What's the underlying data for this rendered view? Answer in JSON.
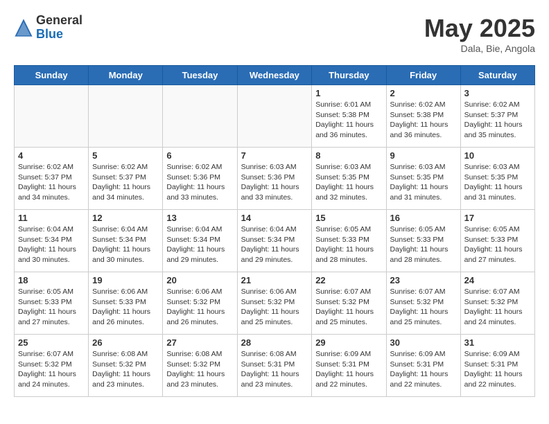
{
  "header": {
    "logo_general": "General",
    "logo_blue": "Blue",
    "month": "May 2025",
    "location": "Dala, Bie, Angola"
  },
  "days_of_week": [
    "Sunday",
    "Monday",
    "Tuesday",
    "Wednesday",
    "Thursday",
    "Friday",
    "Saturday"
  ],
  "weeks": [
    [
      {
        "day": "",
        "info": ""
      },
      {
        "day": "",
        "info": ""
      },
      {
        "day": "",
        "info": ""
      },
      {
        "day": "",
        "info": ""
      },
      {
        "day": "1",
        "info": "Sunrise: 6:01 AM\nSunset: 5:38 PM\nDaylight: 11 hours and 36 minutes."
      },
      {
        "day": "2",
        "info": "Sunrise: 6:02 AM\nSunset: 5:38 PM\nDaylight: 11 hours and 36 minutes."
      },
      {
        "day": "3",
        "info": "Sunrise: 6:02 AM\nSunset: 5:37 PM\nDaylight: 11 hours and 35 minutes."
      }
    ],
    [
      {
        "day": "4",
        "info": "Sunrise: 6:02 AM\nSunset: 5:37 PM\nDaylight: 11 hours and 34 minutes."
      },
      {
        "day": "5",
        "info": "Sunrise: 6:02 AM\nSunset: 5:37 PM\nDaylight: 11 hours and 34 minutes."
      },
      {
        "day": "6",
        "info": "Sunrise: 6:02 AM\nSunset: 5:36 PM\nDaylight: 11 hours and 33 minutes."
      },
      {
        "day": "7",
        "info": "Sunrise: 6:03 AM\nSunset: 5:36 PM\nDaylight: 11 hours and 33 minutes."
      },
      {
        "day": "8",
        "info": "Sunrise: 6:03 AM\nSunset: 5:35 PM\nDaylight: 11 hours and 32 minutes."
      },
      {
        "day": "9",
        "info": "Sunrise: 6:03 AM\nSunset: 5:35 PM\nDaylight: 11 hours and 31 minutes."
      },
      {
        "day": "10",
        "info": "Sunrise: 6:03 AM\nSunset: 5:35 PM\nDaylight: 11 hours and 31 minutes."
      }
    ],
    [
      {
        "day": "11",
        "info": "Sunrise: 6:04 AM\nSunset: 5:34 PM\nDaylight: 11 hours and 30 minutes."
      },
      {
        "day": "12",
        "info": "Sunrise: 6:04 AM\nSunset: 5:34 PM\nDaylight: 11 hours and 30 minutes."
      },
      {
        "day": "13",
        "info": "Sunrise: 6:04 AM\nSunset: 5:34 PM\nDaylight: 11 hours and 29 minutes."
      },
      {
        "day": "14",
        "info": "Sunrise: 6:04 AM\nSunset: 5:34 PM\nDaylight: 11 hours and 29 minutes."
      },
      {
        "day": "15",
        "info": "Sunrise: 6:05 AM\nSunset: 5:33 PM\nDaylight: 11 hours and 28 minutes."
      },
      {
        "day": "16",
        "info": "Sunrise: 6:05 AM\nSunset: 5:33 PM\nDaylight: 11 hours and 28 minutes."
      },
      {
        "day": "17",
        "info": "Sunrise: 6:05 AM\nSunset: 5:33 PM\nDaylight: 11 hours and 27 minutes."
      }
    ],
    [
      {
        "day": "18",
        "info": "Sunrise: 6:05 AM\nSunset: 5:33 PM\nDaylight: 11 hours and 27 minutes."
      },
      {
        "day": "19",
        "info": "Sunrise: 6:06 AM\nSunset: 5:33 PM\nDaylight: 11 hours and 26 minutes."
      },
      {
        "day": "20",
        "info": "Sunrise: 6:06 AM\nSunset: 5:32 PM\nDaylight: 11 hours and 26 minutes."
      },
      {
        "day": "21",
        "info": "Sunrise: 6:06 AM\nSunset: 5:32 PM\nDaylight: 11 hours and 25 minutes."
      },
      {
        "day": "22",
        "info": "Sunrise: 6:07 AM\nSunset: 5:32 PM\nDaylight: 11 hours and 25 minutes."
      },
      {
        "day": "23",
        "info": "Sunrise: 6:07 AM\nSunset: 5:32 PM\nDaylight: 11 hours and 25 minutes."
      },
      {
        "day": "24",
        "info": "Sunrise: 6:07 AM\nSunset: 5:32 PM\nDaylight: 11 hours and 24 minutes."
      }
    ],
    [
      {
        "day": "25",
        "info": "Sunrise: 6:07 AM\nSunset: 5:32 PM\nDaylight: 11 hours and 24 minutes."
      },
      {
        "day": "26",
        "info": "Sunrise: 6:08 AM\nSunset: 5:32 PM\nDaylight: 11 hours and 23 minutes."
      },
      {
        "day": "27",
        "info": "Sunrise: 6:08 AM\nSunset: 5:32 PM\nDaylight: 11 hours and 23 minutes."
      },
      {
        "day": "28",
        "info": "Sunrise: 6:08 AM\nSunset: 5:31 PM\nDaylight: 11 hours and 23 minutes."
      },
      {
        "day": "29",
        "info": "Sunrise: 6:09 AM\nSunset: 5:31 PM\nDaylight: 11 hours and 22 minutes."
      },
      {
        "day": "30",
        "info": "Sunrise: 6:09 AM\nSunset: 5:31 PM\nDaylight: 11 hours and 22 minutes."
      },
      {
        "day": "31",
        "info": "Sunrise: 6:09 AM\nSunset: 5:31 PM\nDaylight: 11 hours and 22 minutes."
      }
    ]
  ]
}
